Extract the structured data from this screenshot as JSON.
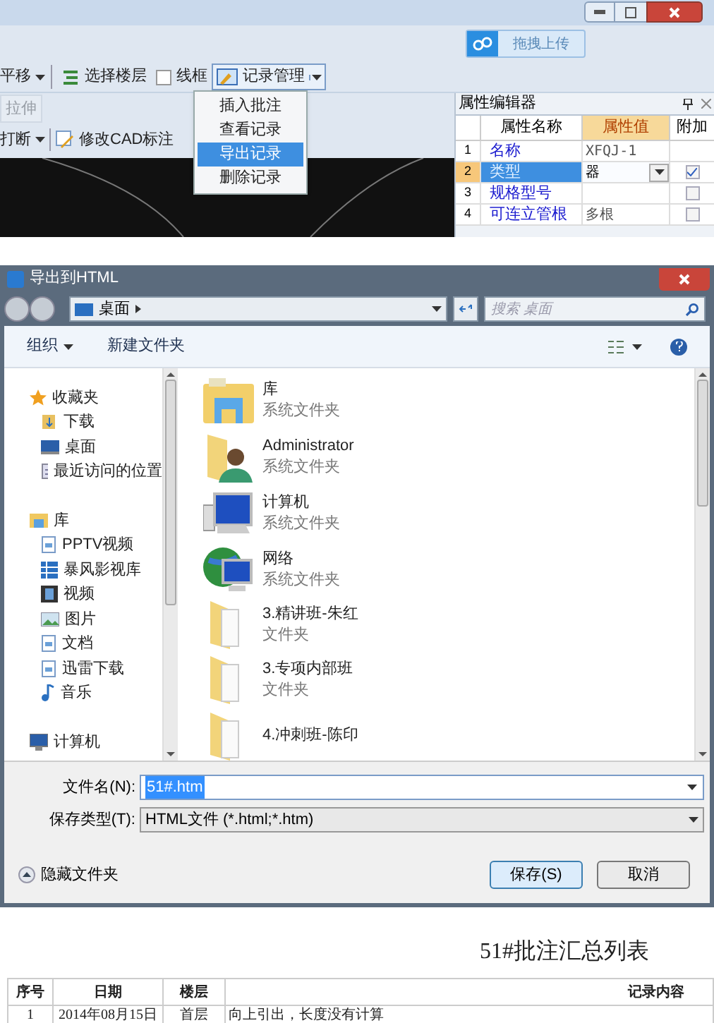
{
  "app": {
    "upload_button": "拖拽上传",
    "toolbar": [
      {
        "label": "平移",
        "kind": "dropdown"
      },
      {
        "label": "选择楼层",
        "kind": "layers"
      },
      {
        "label": "线框",
        "kind": "frame"
      },
      {
        "label": "记录管理",
        "kind": "split",
        "expanded": true
      }
    ],
    "edit_tools": [
      {
        "label": "拉伸",
        "kind": "plain",
        "disabled": true
      },
      {
        "label": "打断",
        "kind": "dropdown",
        "disabled": false
      },
      {
        "label": "修改CAD标注",
        "kind": "cad",
        "disabled": false
      }
    ],
    "menu": [
      {
        "label": "插入批注",
        "selected": false
      },
      {
        "label": "查看记录",
        "selected": false
      },
      {
        "label": "导出记录",
        "selected": true
      },
      {
        "label": "删除记录",
        "selected": false
      }
    ],
    "property_editor": {
      "title": "属性编辑器",
      "columns": [
        "属性名称",
        "属性值",
        "附加"
      ],
      "rows": [
        {
          "index": "1",
          "name": "名称",
          "value": "XFQJ-1",
          "dropdown": false,
          "kind": "plain",
          "selected": false
        },
        {
          "index": "2",
          "name": "类型",
          "value": "器",
          "dropdown": true,
          "kind": "checkbox",
          "checked": true,
          "selected": true
        },
        {
          "index": "3",
          "name": "规格型号",
          "dropdown": false,
          "kind": "checkbox",
          "checked": false,
          "selected": false
        },
        {
          "index": "4",
          "name": "可连立管根",
          "value": "多根",
          "dropdown": false,
          "kind": "checkbox",
          "checked": false,
          "selected": false
        }
      ]
    }
  },
  "dialog": {
    "title": "导出到HTML",
    "address": "桌面",
    "search": {
      "placeholder": "搜索 桌面"
    },
    "organize": "组织",
    "new_folder": "新建文件夹",
    "nav": [
      {
        "label": "收藏夹",
        "children": [
          {
            "label": "下载"
          },
          {
            "label": "桌面"
          },
          {
            "label": "最近访问的位置"
          }
        ]
      },
      {
        "label": "库",
        "children": [
          {
            "label": "PPTV视频"
          },
          {
            "label": "暴风影视库"
          },
          {
            "label": "视频"
          },
          {
            "label": "图片"
          },
          {
            "label": "文档"
          },
          {
            "label": "迅雷下载"
          },
          {
            "label": "音乐"
          }
        ]
      },
      {
        "label": "计算机"
      }
    ],
    "files": [
      {
        "name": "库",
        "type": "系统文件夹"
      },
      {
        "name": "Administrator",
        "type": "系统文件夹"
      },
      {
        "name": "计算机",
        "type": "系统文件夹"
      },
      {
        "name": "网络",
        "type": "系统文件夹"
      },
      {
        "name": "3.精讲班-朱红",
        "type": "文件夹"
      },
      {
        "name": "3.专项内部班",
        "type": "文件夹"
      },
      {
        "name": "4.冲刺班-陈印"
      }
    ],
    "filename": {
      "label": "文件名(N):",
      "value": "51#.htm",
      "selected": true
    },
    "filetype": {
      "label": "保存类型(T):",
      "value": "HTML文件 (*.html;*.htm)"
    },
    "hide_folders": "隐藏文件夹",
    "buttons": [
      {
        "label": "保存(S)",
        "default": true
      },
      {
        "label": "取消",
        "default": false
      }
    ]
  },
  "report": {
    "title": "51#批注汇总列表",
    "columns": [
      "序号",
      "日期",
      "楼层",
      "记录内容"
    ],
    "rows": [
      [
        "1",
        "2014年08月15日",
        "首层",
        "向上引出，长度没有计算"
      ]
    ]
  }
}
